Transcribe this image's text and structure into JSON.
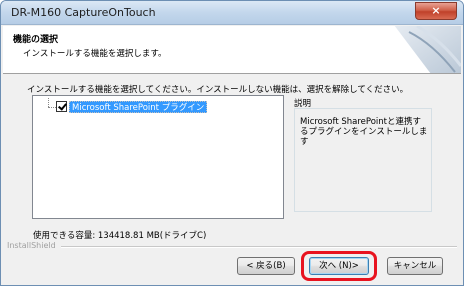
{
  "window": {
    "title": "DR-M160 CaptureOnTouch",
    "close_label": "×"
  },
  "header": {
    "title": "機能の選択",
    "subtitle": "インストールする機能を選択します。"
  },
  "instruction": "インストールする機能を選択してください。インストールしない機能は、選択を解除してください。",
  "features": [
    {
      "label": "Microsoft SharePoint プラグイン",
      "checked": true,
      "selected": true
    }
  ],
  "description": {
    "label": "説明",
    "text": "Microsoft SharePointと連携するプラグインをインストールします"
  },
  "disk_space": "使用できる容量: 134418.81 MB(ドライブC)",
  "brand": "InstallShield",
  "buttons": {
    "back": "< 戻る(B)",
    "next": "次へ (N)>",
    "cancel": "キャンセル"
  },
  "colors": {
    "highlight": "#e8131f",
    "selection": "#3399ff"
  }
}
